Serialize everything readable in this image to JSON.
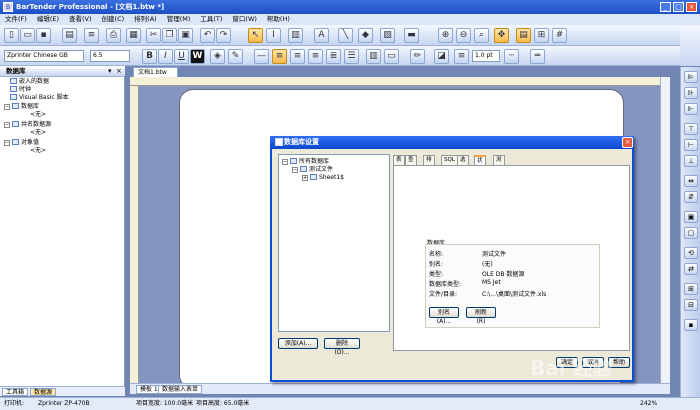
{
  "app": {
    "title": "BarTender Professional - [文档1.btw *]",
    "icon": "B"
  },
  "menu": [
    "文件(F)",
    "编辑(E)",
    "查看(V)",
    "创建(C)",
    "排列(A)",
    "管理(M)",
    "工具(T)",
    "窗口(W)",
    "帮助(H)"
  ],
  "format_bar": {
    "font": "Zprinter Chinese GB",
    "size": "6.5",
    "bold": "B",
    "italic": "I",
    "underline": "U",
    "weight": "W",
    "line_width": "1.0 pt"
  },
  "left_panel": {
    "title": "数据库",
    "tree": [
      {
        "label": "嵌入的数据",
        "indent": 1
      },
      {
        "label": "时钟",
        "indent": 1
      },
      {
        "label": "Visual Basic 脚本",
        "indent": 1
      },
      {
        "label": "数据库",
        "indent": 0
      },
      {
        "label": "<无>",
        "indent": 2
      },
      {
        "label": "共名数据源",
        "indent": 0
      },
      {
        "label": "<无>",
        "indent": 2
      },
      {
        "label": "对象值",
        "indent": 0
      },
      {
        "label": "<无>",
        "indent": 2
      }
    ],
    "tabs": [
      "工具箱",
      "数据源"
    ]
  },
  "document": {
    "tab": "文档1.btw",
    "bottom_tabs": [
      "模板 1",
      "数据输入表单"
    ]
  },
  "dialog": {
    "title": "数据库设置",
    "tree_root": "所有数据库",
    "tree_file": "测试文件",
    "tree_sheet": "Sheet1$",
    "tabs": [
      "表",
      "查询",
      "排序",
      "SQL",
      "选项",
      "状态",
      "浏览"
    ],
    "active_tab": "状态",
    "group_title": "数据库",
    "fields": [
      {
        "key": "名称:",
        "value": "测试文件"
      },
      {
        "key": "别名:",
        "value": "(无)"
      },
      {
        "key": "类型:",
        "value": "OLE DB 数据源"
      },
      {
        "key": "数据库类型:",
        "value": "MS Jet"
      },
      {
        "key": "文件/目录:",
        "value": "C:\\...\\桌面\\测试文件.xls"
      }
    ],
    "btn_alias": "别名(A)...",
    "btn_refresh": "刷新(R)",
    "btn_add": "添加(A)...",
    "btn_delete": "删除(D)...",
    "btn_ok": "确定",
    "btn_cancel": "取消",
    "btn_help": "帮助"
  },
  "status": {
    "printer_label": "打印机:",
    "printer": "Zprinter ZP-470B",
    "width": "项目宽度: 100.0毫米",
    "height": "项目高度: 65.0毫米",
    "zoom": "242%"
  },
  "watermark": "Bai 经验"
}
